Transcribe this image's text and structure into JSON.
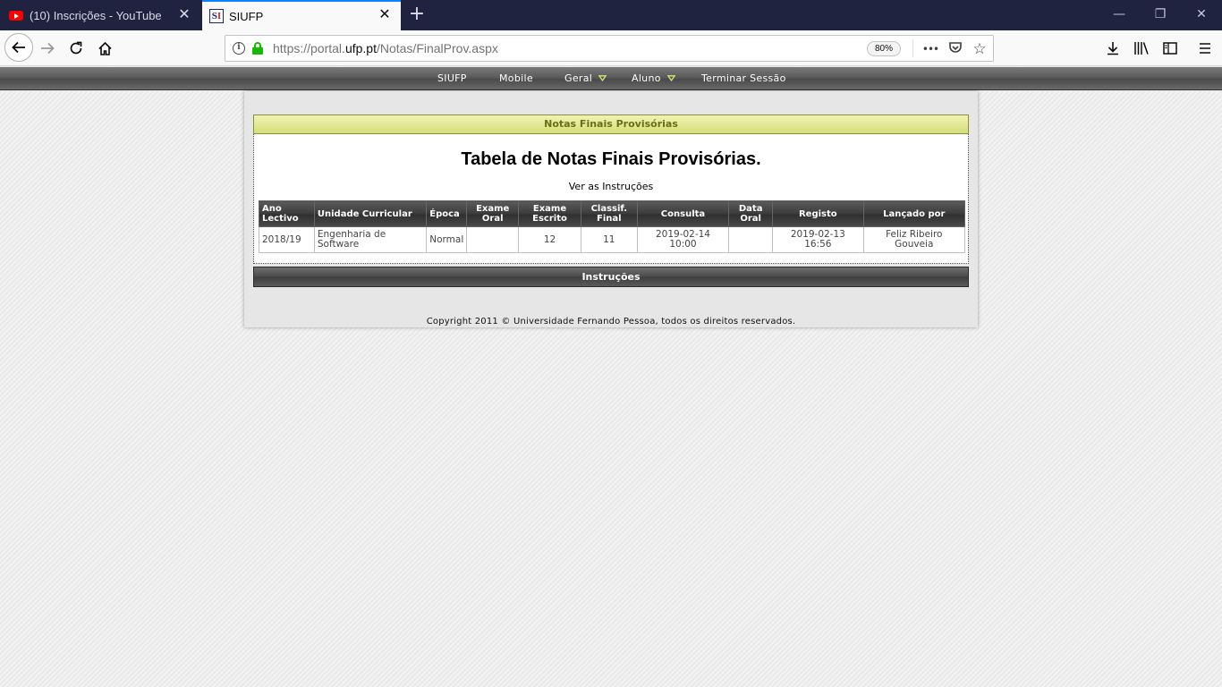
{
  "browser": {
    "tabs": [
      {
        "title": "(10) Inscrições - YouTube",
        "icon": "youtube-icon",
        "active": false
      },
      {
        "title": "SIUFP",
        "icon": "siufp-icon",
        "active": true
      }
    ],
    "favicon_siufp": {
      "letter1": "S",
      "letter2": "I"
    },
    "new_tab_glyph": "+",
    "close_glyph": "✕",
    "window_controls": {
      "minimize": "—",
      "restore": "❐",
      "close": "✕"
    },
    "url": {
      "prefix": "https://portal.",
      "domain": "ufp.pt",
      "path": "/Notas/FinalProv.aspx"
    },
    "zoom": "80%",
    "url_actions": {
      "more": "•••",
      "pocket": "◡",
      "bookmark": "☆"
    },
    "nav_glyphs": {
      "back": "←",
      "forward": "→",
      "reload": "↻",
      "home": "⌂"
    },
    "toolbar_glyphs": {
      "downloads": "⤓",
      "library": "|||\\",
      "sidebar": "▥",
      "menu": "☰"
    },
    "info_glyph": "i"
  },
  "site_menu": {
    "items": [
      {
        "label": "SIUFP",
        "has_dropdown": false
      },
      {
        "label": "Mobile",
        "has_dropdown": false
      },
      {
        "label": "Geral",
        "has_dropdown": true
      },
      {
        "label": "Aluno",
        "has_dropdown": true
      },
      {
        "label": "Terminar Sessão",
        "has_dropdown": false
      }
    ],
    "accent_color": "#d7e27a"
  },
  "page": {
    "section_title": "Notas Finais Provisórias",
    "heading": "Tabela de Notas Finais Provisórias.",
    "instructions_link": "Ver as Instruções",
    "instructions_bar": "Instruções",
    "copyright": "Copyright 2011 © Universidade Fernando Pessoa, todos os direitos reservados."
  },
  "grades_table": {
    "headers": [
      {
        "line1": "Ano",
        "line2": "Lectivo"
      },
      {
        "line1": "Unidade Curricular",
        "line2": ""
      },
      {
        "line1": "Época",
        "line2": ""
      },
      {
        "line1": "Exame",
        "line2": "Oral"
      },
      {
        "line1": "Exame",
        "line2": "Escrito"
      },
      {
        "line1": "Classif.",
        "line2": "Final"
      },
      {
        "line1": "Consulta",
        "line2": ""
      },
      {
        "line1": "Data",
        "line2": "Oral"
      },
      {
        "line1": "Registo",
        "line2": ""
      },
      {
        "line1": "Lançado por",
        "line2": ""
      }
    ],
    "rows": [
      {
        "ano_lectivo": "2018/19",
        "unidade_curricular": {
          "line1": "Engenharia de",
          "line2": "Software"
        },
        "epoca": "Normal",
        "exame_oral": "",
        "exame_escrito": "12",
        "classif_final": "11",
        "consulta": {
          "line1": "2019-02-14",
          "line2": "10:00"
        },
        "data_oral": "",
        "registo": {
          "line1": "2019-02-13",
          "line2": "16:56"
        },
        "lancado_por": {
          "line1": "Feliz Ribeiro",
          "line2": "Gouveia"
        }
      }
    ]
  }
}
